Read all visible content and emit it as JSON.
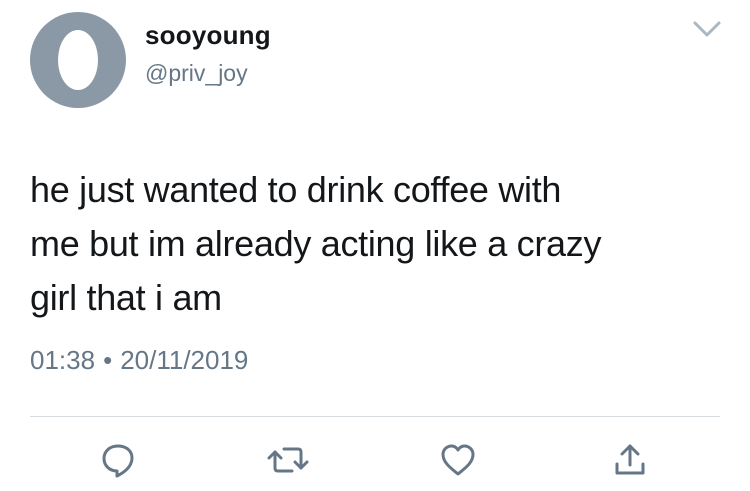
{
  "user": {
    "display_name": "sooyoung",
    "handle": "@priv_joy"
  },
  "tweet": {
    "line1": "he just wanted to drink coffee with",
    "line2": "me but im already acting like a crazy",
    "line3": "girl that i am",
    "time": "01:38",
    "separator": "•",
    "date": "20/11/2019"
  },
  "icons": {
    "menu": "chevron-down-icon",
    "reply": "reply-icon",
    "retweet": "retweet-icon",
    "like": "heart-icon",
    "share": "share-icon"
  },
  "colors": {
    "text": "#14171a",
    "secondary": "#657786",
    "avatar_bg": "#8b99a6",
    "icon": "#657786",
    "divider": "#d8dde1"
  }
}
